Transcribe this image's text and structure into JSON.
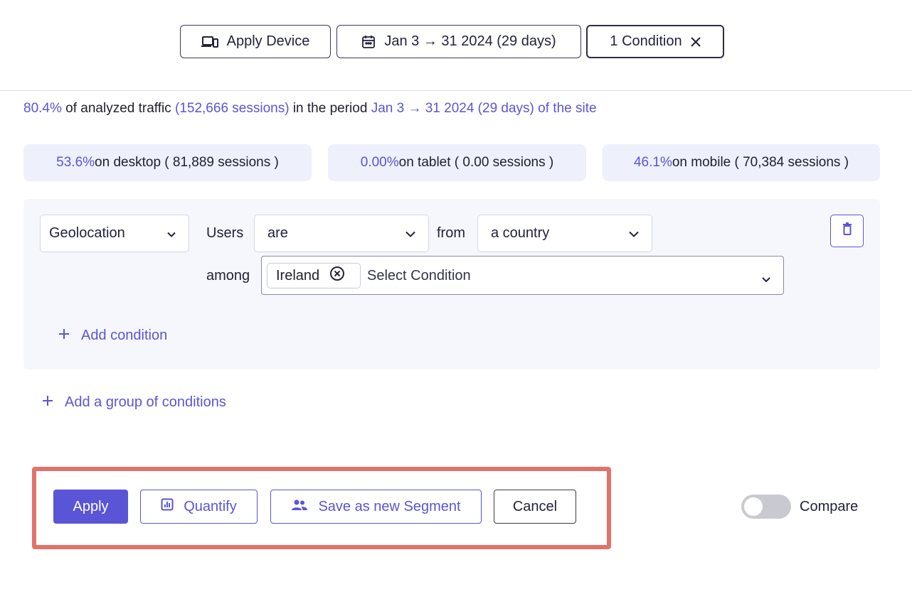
{
  "top_bar": {
    "device_label": "Apply Device",
    "date_label": "Jan 3 → 31 2024 (29 days)",
    "condition_label": "1 Condition"
  },
  "traffic": {
    "percent": "80.4%",
    "text_1": " of analyzed traffic ",
    "sessions": "(152,666 sessions)",
    "text_2": " in the period ",
    "period": "Jan 3 → 31 2024 (29 days) of the site"
  },
  "devices": {
    "desktop": {
      "percent": "53.6%",
      "text": " on desktop ( 81,889 sessions )"
    },
    "tablet": {
      "percent": "0.00%",
      "text": " on tablet ( 0.00 sessions )"
    },
    "mobile": {
      "percent": "46.1%",
      "text": " on mobile ( 70,384 sessions )"
    }
  },
  "condition": {
    "type_value": "Geolocation",
    "subject": "Users",
    "operator_value": "are",
    "from_word": "from",
    "scope_value": "a country",
    "among_word": "among",
    "chips": [
      "Ireland"
    ],
    "select_placeholder": "Select Condition",
    "add_condition": "Add condition"
  },
  "add_group": "Add a group of conditions",
  "actions": {
    "apply": "Apply",
    "quantify": "Quantify",
    "save_segment": "Save as new Segment",
    "cancel": "Cancel"
  },
  "compare": {
    "label": "Compare",
    "enabled": false
  },
  "colors": {
    "accent": "#5a55d6",
    "highlight_border": "#e2736a",
    "panel_bg": "#f6f7fc",
    "pill_bg": "#eef0fb"
  },
  "icons": {
    "device": "devices-icon",
    "date": "calendar-icon",
    "close": "close-icon",
    "chevron": "chevron-down-icon",
    "chip_remove": "circle-x-icon",
    "trash": "trash-icon",
    "plus": "plus-icon",
    "quantify": "bar-chart-icon",
    "segment": "users-icon"
  }
}
